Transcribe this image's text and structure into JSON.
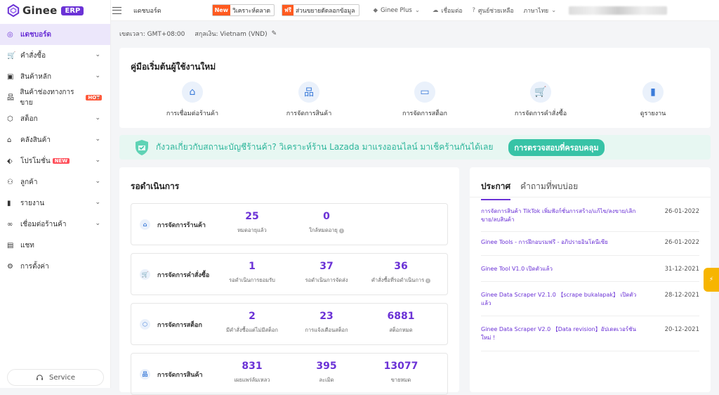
{
  "brand": {
    "name": "Ginee",
    "badge": "ERP"
  },
  "sidebar": {
    "items": [
      {
        "label": "แดชบอร์ด",
        "icon": "dashboard-icon",
        "active": true
      },
      {
        "label": "คำสั่งซื้อ",
        "icon": "cart-icon",
        "chevron": true
      },
      {
        "label": "สินค้าหลัก",
        "icon": "bag-icon",
        "chevron": true
      },
      {
        "label": "สินค้าช่องทางการขาย",
        "icon": "sitemap-icon",
        "chevron": true,
        "tag": "HOT"
      },
      {
        "label": "สต็อก",
        "icon": "cube-icon",
        "chevron": true
      },
      {
        "label": "คลังสินค้า",
        "icon": "warehouse-icon",
        "chevron": true
      },
      {
        "label": "โปรโมชั่น",
        "icon": "tag-icon",
        "chevron": true,
        "tag": "NEW"
      },
      {
        "label": "ลูกค้า",
        "icon": "users-icon",
        "chevron": true
      },
      {
        "label": "รายงาน",
        "icon": "bar-chart-icon",
        "chevron": true
      },
      {
        "label": "เชื่อมต่อร้านค้า",
        "icon": "link-icon",
        "chevron": true
      },
      {
        "label": "แชท",
        "icon": "chat-icon"
      },
      {
        "label": "การตั้งค่า",
        "icon": "gear-icon"
      }
    ],
    "service": "Service"
  },
  "topbar": {
    "page": "แดชบอร์ด",
    "btn1_badge": "New",
    "btn1_label": "วิเคราะห์ตลาด",
    "btn2_badge": "ฟรี",
    "btn2_label": "ส่วนขยายดัดลอกข้อมูล",
    "plus": "Ginee Plus",
    "connect": "เชื่อมต่อ",
    "help": "ศูนย์ช่วยเหลือ",
    "lang": "ภาษาไทย"
  },
  "meta": {
    "timezone": "เขตเวลา: GMT+08:00",
    "currency": "สกุลเงิน: Vietnam (VND)"
  },
  "guide": {
    "title": "คู่มือเริ่มต้นผู้ใช้งานใหม่",
    "steps": [
      {
        "label": "การเชื่อมต่อร้านค้า",
        "icon": "store-icon"
      },
      {
        "label": "การจัดการสินค้า",
        "icon": "sitemap-icon"
      },
      {
        "label": "การจัดการสต็อก",
        "icon": "box-icon"
      },
      {
        "label": "การจัดการคำสั่งซื้อ",
        "icon": "cart-icon"
      },
      {
        "label": "ดูรายงาน",
        "icon": "bar-chart-icon"
      }
    ]
  },
  "banner": {
    "text": "กังวลเกี่ยวกับสถานะบัญชีร้านค้า? วิเคราะห์ร้าน Lazada มาแรงออนไลน์ มาเช็คร้านกันได้เลย",
    "button": "การตรวจสอบที่ครอบคลุม"
  },
  "pending": {
    "title": "รอดำเนินการ",
    "cards": [
      {
        "label": "การจัดการร้านค้า",
        "icon": "store-icon",
        "stats": [
          {
            "value": "25",
            "label": "หมดอายุแล้ว"
          },
          {
            "value": "0",
            "label": "ใกล้หมดอายุ",
            "info": true
          }
        ]
      },
      {
        "label": "การจัดการคำสั่งซื้อ",
        "icon": "cart-icon",
        "stats": [
          {
            "value": "1",
            "label": "รอดำเนินการยอมรับ"
          },
          {
            "value": "37",
            "label": "รอดำเนินการจัดส่ง"
          },
          {
            "value": "36",
            "label": "คำสั่งซื้อที่รอดำเนินการ",
            "info": true
          }
        ]
      },
      {
        "label": "การจัดการสต็อก",
        "icon": "cube-icon",
        "stats": [
          {
            "value": "2",
            "label": "มีคำสั่งซื้อแต่ไม่มีสต็อก"
          },
          {
            "value": "23",
            "label": "การแจ้งเตือนสต็อก"
          },
          {
            "value": "6881",
            "label": "สต็อกหมด"
          }
        ]
      },
      {
        "label": "การจัดการสินค้า",
        "icon": "sitemap-icon",
        "stats": [
          {
            "value": "831",
            "label": "เผยแพร่ล้มเหลว"
          },
          {
            "value": "395",
            "label": "ละเมิด"
          },
          {
            "value": "13077",
            "label": "ขายหมด"
          }
        ]
      }
    ]
  },
  "announcements": {
    "tabs": [
      "ประกาศ",
      "คำถามที่พบบ่อย"
    ],
    "items": [
      {
        "text": "การจัดการสินค้า TikTok เพิ่มฟังก์ชั่นการสร้าง/แก้ไข/ลงขาย/เลิกขาย/ลบสินค้า",
        "date": "26-01-2022"
      },
      {
        "text": "Ginee Tools - การฝึกอบรมฟรี - อภิปรายอินโดนีเซีย",
        "date": "26-01-2022"
      },
      {
        "text": "Ginee Tool V1.0 เปิดตัวแล้ว",
        "date": "31-12-2021"
      },
      {
        "text": "Ginee Data Scraper V2.1.0 【scrape bukalapak】 เปิดตัวแล้ว",
        "date": "28-12-2021"
      },
      {
        "text": "Ginee Data Scraper V2.0 【Data revision】อัปเดตเวอร์ชันใหม่ !",
        "date": "20-12-2021"
      }
    ]
  },
  "colors": {
    "accent": "#6b32d6",
    "banner": "#2bb59a",
    "float": "#f7b500"
  }
}
